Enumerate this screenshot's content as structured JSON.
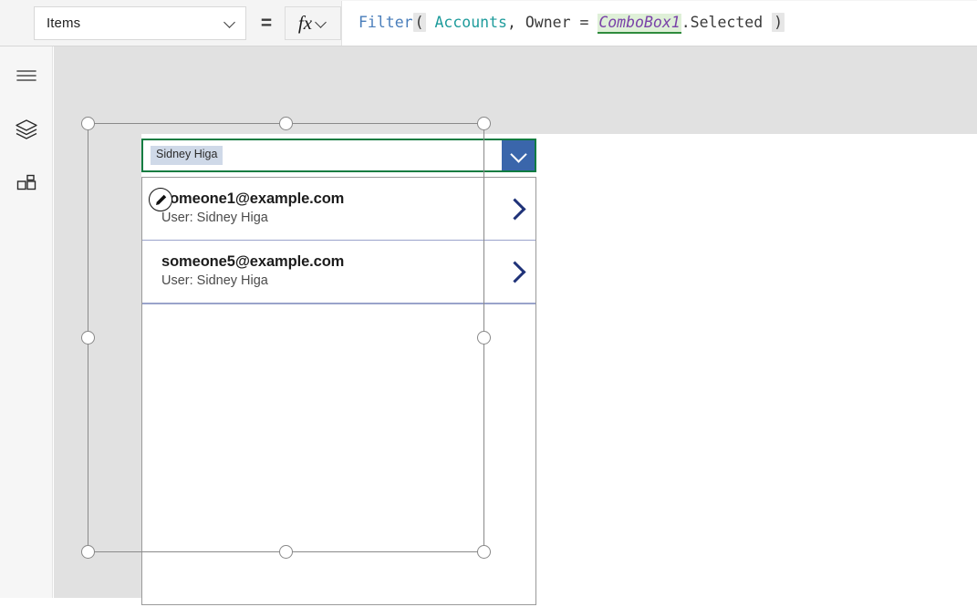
{
  "formula_bar": {
    "property_label": "Items",
    "property_dropdown_icon": "chevron-down-icon",
    "equals_sign": "=",
    "fx_label": "fx",
    "fx_dropdown_icon": "chevron-down-icon",
    "formula_tokens": [
      {
        "text": "Filter",
        "kind": "fn"
      },
      {
        "text": "(",
        "kind": "paren"
      },
      {
        "text": " ",
        "kind": "plain"
      },
      {
        "text": "Accounts",
        "kind": "tbl"
      },
      {
        "text": ", Owner = ",
        "kind": "plain"
      },
      {
        "text": "ComboBox1",
        "kind": "ctrl"
      },
      {
        "text": ".Selected ",
        "kind": "plain"
      },
      {
        "text": ")",
        "kind": "paren"
      }
    ],
    "formula_plain": "Filter( Accounts, Owner = ComboBox1.Selected )"
  },
  "rail": {
    "items": [
      {
        "name": "menu-icon",
        "title": "Menu"
      },
      {
        "name": "layers-icon",
        "title": "Tree view"
      },
      {
        "name": "components-icon",
        "title": "Insert"
      }
    ]
  },
  "combobox": {
    "selected_chip": "Sidney Higa",
    "dropdown_icon": "chevron-down-icon",
    "accent_color": "#3a66ab",
    "selection_border_color": "#107c41",
    "chip_background": "#cfd9e8"
  },
  "gallery": {
    "selected": true,
    "divider_color": "#9aa3cb",
    "chevron_color": "#1f3278",
    "edit_badge_icon": "edit-pencil-icon",
    "items": [
      {
        "title": "someone1@example.com",
        "subtitle": "User: Sidney Higa",
        "chevron_icon": "chevron-right-icon",
        "has_edit_badge": true
      },
      {
        "title": "someone5@example.com",
        "subtitle": "User: Sidney Higa",
        "chevron_icon": "chevron-right-icon",
        "has_edit_badge": false
      }
    ]
  },
  "canvas": {
    "background": "#ffffff",
    "workspace_background": "#e1e1e1"
  }
}
